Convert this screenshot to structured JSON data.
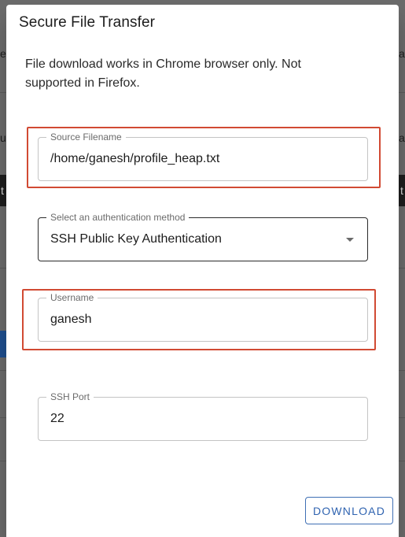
{
  "background": {
    "fragment_left_1": "e.",
    "fragment_right_1": "a",
    "fragment_left_2": "ur",
    "fragment_right_2": "a",
    "fragment_left_dark": "t",
    "fragment_right_dark": "t"
  },
  "dialog": {
    "title": "Secure File Transfer",
    "note": "File download works in Chrome browser only. Not supported in Firefox.",
    "fields": {
      "source_filename": {
        "label": "Source Filename",
        "value": "/home/ganesh/profile_heap.txt"
      },
      "auth_method": {
        "label": "Select an authentication method",
        "value": "SSH Public Key Authentication"
      },
      "username": {
        "label": "Username",
        "value": "ganesh"
      },
      "ssh_port": {
        "label": "SSH Port",
        "value": "22"
      }
    },
    "download_label": "DOWNLOAD"
  },
  "colors": {
    "highlight": "#d14a33",
    "accent": "#2f63b0"
  }
}
